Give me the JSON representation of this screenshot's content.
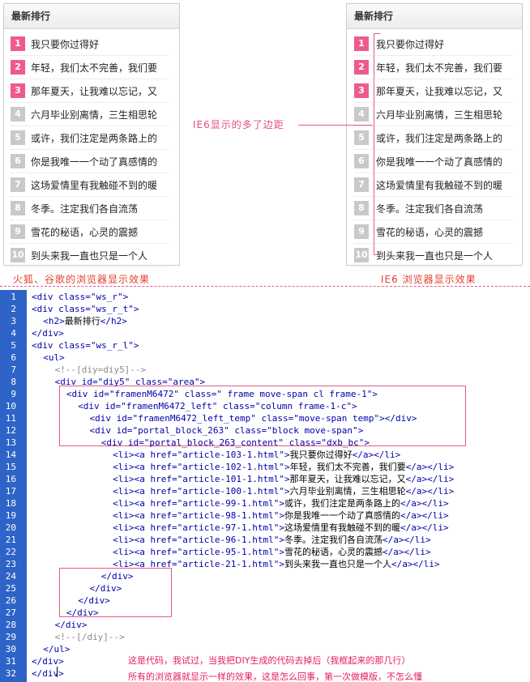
{
  "left_panel": {
    "title": "最新排行",
    "items": [
      {
        "num": "1",
        "text": "我只要你过得好"
      },
      {
        "num": "2",
        "text": "年轻，我们太不完善，我们要"
      },
      {
        "num": "3",
        "text": "那年夏天，让我难以忘记，又"
      },
      {
        "num": "4",
        "text": "六月毕业别离情，三生相思轮"
      },
      {
        "num": "5",
        "text": "或许，我们注定是两条路上的"
      },
      {
        "num": "6",
        "text": "你是我唯一一个动了真感情的"
      },
      {
        "num": "7",
        "text": "这场爱情里有我触碰不到的暖"
      },
      {
        "num": "8",
        "text": "冬季。注定我们各自流荡"
      },
      {
        "num": "9",
        "text": "雪花的秘语，心灵的震撼"
      },
      {
        "num": "10",
        "text": "到头来我一直也只是一个人"
      }
    ]
  },
  "right_panel": {
    "title": "最新排行",
    "items": [
      {
        "num": "1",
        "text": "我只要你过得好"
      },
      {
        "num": "2",
        "text": "年轻，我们太不完善，我们要"
      },
      {
        "num": "3",
        "text": "那年夏天，让我难以忘记，又"
      },
      {
        "num": "4",
        "text": "六月毕业别离情，三生相思轮"
      },
      {
        "num": "5",
        "text": "或许，我们注定是两条路上的"
      },
      {
        "num": "6",
        "text": "你是我唯一一个动了真感情的"
      },
      {
        "num": "7",
        "text": "这场爱情里有我触碰不到的暖"
      },
      {
        "num": "8",
        "text": "冬季。注定我们各自流荡"
      },
      {
        "num": "9",
        "text": "雪花的秘语，心灵的震撼"
      },
      {
        "num": "10",
        "text": "到头来我一直也只是一个人"
      }
    ]
  },
  "annotations": {
    "ie6_extra_margin": "IE6显示的多了边距",
    "left_caption": "火狐、谷歌的浏览器显示效果",
    "right_caption": "IE6 浏览器显示效果",
    "note_line1": "这是代码，我试过，当我把DIY生成的代码去掉后（我框起来的那几行）",
    "note_line2": "所有的浏览器就显示一样的效果，这是怎么回事，第一次做模版，不怎么懂"
  },
  "code_lines": [
    {
      "num": "1",
      "indent": 0,
      "tokens": [
        [
          "tag",
          "<div "
        ],
        [
          "attr",
          "class="
        ],
        [
          "str",
          "\"ws_r\""
        ],
        [
          "tag",
          ">"
        ]
      ]
    },
    {
      "num": "2",
      "indent": 0,
      "tokens": [
        [
          "tag",
          "<div "
        ],
        [
          "attr",
          "class="
        ],
        [
          "str",
          "\"ws_r_t\""
        ],
        [
          "tag",
          ">"
        ]
      ]
    },
    {
      "num": "3",
      "indent": 1,
      "tokens": [
        [
          "tag",
          "<h2>"
        ],
        [
          "txt",
          "最新排行"
        ],
        [
          "tag",
          "</h2>"
        ]
      ]
    },
    {
      "num": "4",
      "indent": 0,
      "tokens": [
        [
          "tag",
          "</div>"
        ]
      ]
    },
    {
      "num": "5",
      "indent": 0,
      "tokens": [
        [
          "tag",
          "<div "
        ],
        [
          "attr",
          "class="
        ],
        [
          "str",
          "\"ws_r_l\""
        ],
        [
          "tag",
          ">"
        ]
      ]
    },
    {
      "num": "6",
      "indent": 1,
      "tokens": [
        [
          "tag",
          "<ul>"
        ]
      ]
    },
    {
      "num": "7",
      "indent": 2,
      "tokens": [
        [
          "cmt",
          "<!--[diy=diy5]-->"
        ]
      ]
    },
    {
      "num": "8",
      "indent": 2,
      "tokens": [
        [
          "tag",
          "<div "
        ],
        [
          "attr",
          "id="
        ],
        [
          "str",
          "\"diy5\" "
        ],
        [
          "attr",
          "class="
        ],
        [
          "str",
          "\"area\""
        ],
        [
          "tag",
          ">"
        ]
      ]
    },
    {
      "num": "9",
      "indent": 3,
      "tokens": [
        [
          "tag",
          "<div "
        ],
        [
          "attr",
          "id="
        ],
        [
          "str",
          "\"framenM6472\" "
        ],
        [
          "attr",
          "class="
        ],
        [
          "str",
          "\" frame move-span cl frame-1\""
        ],
        [
          "tag",
          ">"
        ]
      ]
    },
    {
      "num": "10",
      "indent": 4,
      "tokens": [
        [
          "tag",
          "<div "
        ],
        [
          "attr",
          "id="
        ],
        [
          "str",
          "\"framenM6472_left\" "
        ],
        [
          "attr",
          "class="
        ],
        [
          "str",
          "\"column frame-1-c\""
        ],
        [
          "tag",
          ">"
        ]
      ]
    },
    {
      "num": "11",
      "indent": 5,
      "tokens": [
        [
          "tag",
          "<div "
        ],
        [
          "attr",
          "id="
        ],
        [
          "str",
          "\"framenM6472_left_temp\" "
        ],
        [
          "attr",
          "class="
        ],
        [
          "str",
          "\"move-span temp\""
        ],
        [
          "tag",
          "></div>"
        ]
      ]
    },
    {
      "num": "12",
      "indent": 5,
      "tokens": [
        [
          "tag",
          "<div "
        ],
        [
          "attr",
          "id="
        ],
        [
          "str",
          "\"portal_block_263\" "
        ],
        [
          "attr",
          "class="
        ],
        [
          "str",
          "\"block move-span\""
        ],
        [
          "tag",
          ">"
        ]
      ]
    },
    {
      "num": "13",
      "indent": 6,
      "tokens": [
        [
          "tag",
          "<div "
        ],
        [
          "attr",
          "id="
        ],
        [
          "str",
          "\"portal_block_263_content\" "
        ],
        [
          "attr",
          "class="
        ],
        [
          "str",
          "\"dxb_bc\""
        ],
        [
          "tag",
          ">"
        ]
      ]
    },
    {
      "num": "14",
      "indent": 7,
      "tokens": [
        [
          "tag",
          "<li><a "
        ],
        [
          "attr",
          "href="
        ],
        [
          "str",
          "\"article-103-1.html\""
        ],
        [
          "tag",
          ">"
        ],
        [
          "txt",
          "我只要你过得好"
        ],
        [
          "tag",
          "</a></li>"
        ]
      ]
    },
    {
      "num": "15",
      "indent": 7,
      "tokens": [
        [
          "tag",
          "<li><a "
        ],
        [
          "attr",
          "href="
        ],
        [
          "str",
          "\"article-102-1.html\""
        ],
        [
          "tag",
          ">"
        ],
        [
          "txt",
          "年轻，我们太不完善，我们要"
        ],
        [
          "tag",
          "</a></li>"
        ]
      ]
    },
    {
      "num": "16",
      "indent": 7,
      "tokens": [
        [
          "tag",
          "<li><a "
        ],
        [
          "attr",
          "href="
        ],
        [
          "str",
          "\"article-101-1.html\""
        ],
        [
          "tag",
          ">"
        ],
        [
          "txt",
          "那年夏天，让我难以忘记，又"
        ],
        [
          "tag",
          "</a></li>"
        ]
      ]
    },
    {
      "num": "17",
      "indent": 7,
      "tokens": [
        [
          "tag",
          "<li><a "
        ],
        [
          "attr",
          "href="
        ],
        [
          "str",
          "\"article-100-1.html\""
        ],
        [
          "tag",
          ">"
        ],
        [
          "txt",
          "六月毕业别离情，三生相思轮"
        ],
        [
          "tag",
          "</a></li>"
        ]
      ]
    },
    {
      "num": "18",
      "indent": 7,
      "tokens": [
        [
          "tag",
          "<li><a "
        ],
        [
          "attr",
          "href="
        ],
        [
          "str",
          "\"article-99-1.html\""
        ],
        [
          "tag",
          ">"
        ],
        [
          "txt",
          "或许，我们注定是两条路上的"
        ],
        [
          "tag",
          "</a></li>"
        ]
      ]
    },
    {
      "num": "19",
      "indent": 7,
      "tokens": [
        [
          "tag",
          "<li><a "
        ],
        [
          "attr",
          "href="
        ],
        [
          "str",
          "\"article-98-1.html\""
        ],
        [
          "tag",
          ">"
        ],
        [
          "txt",
          "你是我唯一一个动了真感情的"
        ],
        [
          "tag",
          "</a></li>"
        ]
      ]
    },
    {
      "num": "20",
      "indent": 7,
      "tokens": [
        [
          "tag",
          "<li><a "
        ],
        [
          "attr",
          "href="
        ],
        [
          "str",
          "\"article-97-1.html\""
        ],
        [
          "tag",
          ">"
        ],
        [
          "txt",
          "这场爱情里有我触碰不到的暖"
        ],
        [
          "tag",
          "</a></li>"
        ]
      ]
    },
    {
      "num": "21",
      "indent": 7,
      "tokens": [
        [
          "tag",
          "<li><a "
        ],
        [
          "attr",
          "href="
        ],
        [
          "str",
          "\"article-96-1.html\""
        ],
        [
          "tag",
          ">"
        ],
        [
          "txt",
          "冬季。注定我们各自流荡"
        ],
        [
          "tag",
          "</a></li>"
        ]
      ]
    },
    {
      "num": "22",
      "indent": 7,
      "tokens": [
        [
          "tag",
          "<li><a "
        ],
        [
          "attr",
          "href="
        ],
        [
          "str",
          "\"article-95-1.html\""
        ],
        [
          "tag",
          ">"
        ],
        [
          "txt",
          "雪花的秘语，心灵的震撼"
        ],
        [
          "tag",
          "</a></li>"
        ]
      ]
    },
    {
      "num": "23",
      "indent": 7,
      "tokens": [
        [
          "tag",
          "<li><a "
        ],
        [
          "attr",
          "href="
        ],
        [
          "str",
          "\"article-21-1.html\""
        ],
        [
          "tag",
          ">"
        ],
        [
          "txt",
          "到头来我一直也只是一个人"
        ],
        [
          "tag",
          "</a></li>"
        ]
      ]
    },
    {
      "num": "24",
      "indent": 6,
      "tokens": [
        [
          "tag",
          "</div>"
        ]
      ]
    },
    {
      "num": "25",
      "indent": 5,
      "tokens": [
        [
          "tag",
          "</div>"
        ]
      ]
    },
    {
      "num": "26",
      "indent": 4,
      "tokens": [
        [
          "tag",
          "</div>"
        ]
      ]
    },
    {
      "num": "27",
      "indent": 3,
      "tokens": [
        [
          "tag",
          "</div>"
        ]
      ]
    },
    {
      "num": "28",
      "indent": 2,
      "tokens": [
        [
          "tag",
          "</div>"
        ]
      ]
    },
    {
      "num": "29",
      "indent": 2,
      "tokens": [
        [
          "cmt",
          "<!--[/diy]-->"
        ]
      ]
    },
    {
      "num": "30",
      "indent": 1,
      "tokens": [
        [
          "tag",
          "</ul>"
        ]
      ]
    },
    {
      "num": "31",
      "indent": 0,
      "tokens": [
        [
          "tag",
          "</div>"
        ]
      ]
    },
    {
      "num": "32",
      "indent": 0,
      "tokens": [
        [
          "tag",
          "</div>"
        ]
      ]
    }
  ],
  "colors": {
    "accent_pink": "#e35a8a",
    "hot_rank": "#ef5a8c",
    "cold_rank": "#c9c9c9",
    "gutter": "#2e63c7",
    "caption_red": "#e2402e"
  }
}
